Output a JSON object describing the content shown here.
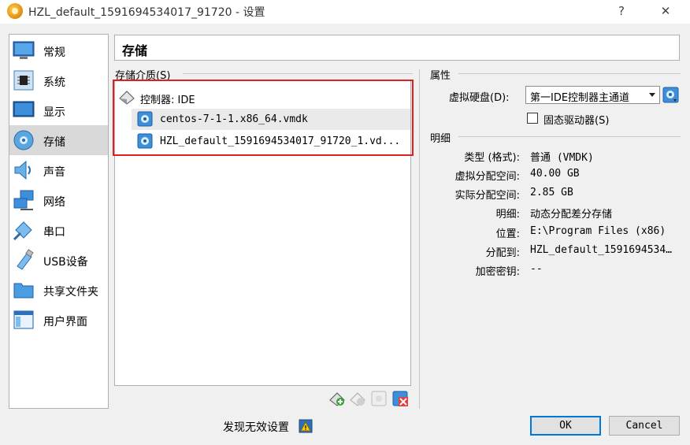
{
  "window": {
    "title": "HZL_default_1591694534017_91720 - 设置",
    "help_label": "?",
    "close_label": "✕"
  },
  "nav": {
    "items": [
      {
        "label": "常规",
        "icon": "monitor-icon"
      },
      {
        "label": "系统",
        "icon": "chip-icon"
      },
      {
        "label": "显示",
        "icon": "display-icon"
      },
      {
        "label": "存储",
        "icon": "disk-icon",
        "selected": true
      },
      {
        "label": "声音",
        "icon": "speaker-icon"
      },
      {
        "label": "网络",
        "icon": "network-icon"
      },
      {
        "label": "串口",
        "icon": "serial-port-icon"
      },
      {
        "label": "USB设备",
        "icon": "usb-icon"
      },
      {
        "label": "共享文件夹",
        "icon": "folder-icon"
      },
      {
        "label": "用户界面",
        "icon": "window-icon"
      }
    ]
  },
  "header": {
    "title": "存储"
  },
  "storage": {
    "section_label": "存储介质(S)",
    "controller": "控制器: IDE",
    "disks": [
      {
        "name": "centos-7-1-1.x86_64.vmdk",
        "selected": true
      },
      {
        "name": "HZL_default_1591694534017_91720_1.vd..."
      }
    ],
    "tools": [
      "add-controller-icon",
      "remove-controller-icon",
      "add-attachment-icon",
      "remove-attachment-icon"
    ]
  },
  "attributes": {
    "section_label": "属性",
    "hard_disk_label": "虚拟硬盘(D):",
    "hard_disk_value": "第一IDE控制器主通道",
    "ssd_label": "固态驱动器(S)",
    "ssd_checked": false
  },
  "details": {
    "section_label": "明细",
    "rows": [
      {
        "label": "类型 (格式):",
        "value": "普通  (VMDK)"
      },
      {
        "label": "虚拟分配空间:",
        "value": "40.00  GB"
      },
      {
        "label": "实际分配空间:",
        "value": "2.85  GB"
      },
      {
        "label": "明细:",
        "value": "动态分配差分存储"
      },
      {
        "label": "位置:",
        "value": "E:\\Program  Files  (x86)"
      },
      {
        "label": "分配到:",
        "value": "HZL_default_1591694534…"
      },
      {
        "label": "加密密钥:",
        "value": "--"
      }
    ]
  },
  "footer": {
    "invalid_settings": "发现无效设置",
    "ok_label": "OK",
    "cancel_label": "Cancel"
  },
  "colors": {
    "highlight_frame": "#e02020",
    "ok_border": "#0078d7"
  }
}
